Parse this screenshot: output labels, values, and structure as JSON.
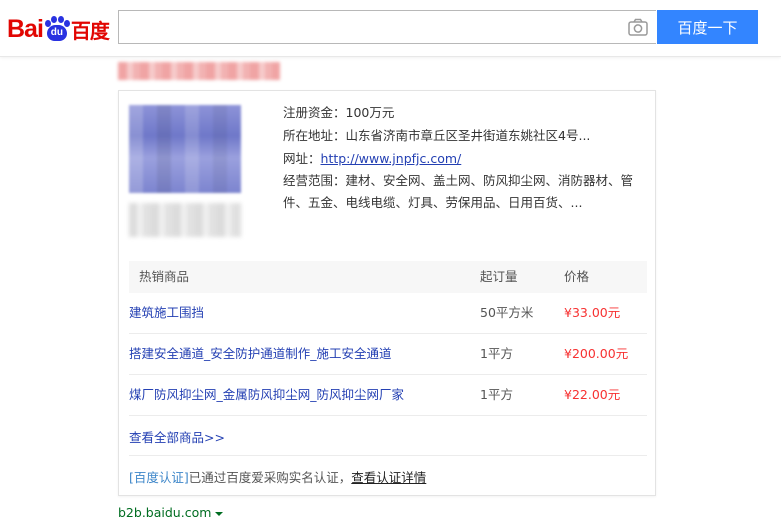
{
  "header": {
    "logo": {
      "latin": "Bai",
      "paw_text": "du",
      "chinese": "百度"
    },
    "search": {
      "value": "",
      "placeholder": ""
    },
    "search_button_label": "百度一下"
  },
  "card": {
    "info": {
      "capital_label": "注册资金：",
      "capital_value": "100万元",
      "address_label": "所在地址：",
      "address_value": "山东省济南市章丘区圣井街道东姚社区4号...",
      "website_label": "网址：",
      "website_url": "http://www.jnpfjc.com/",
      "scope_label": "经营范围：",
      "scope_value": "建材、安全网、盖土网、防风抑尘网、消防器材、管件、五金、电线电缆、灯具、劳保用品、日用百货、..."
    },
    "table": {
      "headers": [
        "热销商品",
        "起订量",
        "价格"
      ],
      "rows": [
        {
          "name": "建筑施工围挡",
          "moq": "50平方米",
          "price": "¥33.00元"
        },
        {
          "name": "搭建安全通道_安全防护通道制作_施工安全通道",
          "moq": "1平方",
          "price": "¥200.00元"
        },
        {
          "name": "煤厂防风抑尘网_金属防风抑尘网_防风抑尘网厂家",
          "moq": "1平方",
          "price": "¥22.00元"
        }
      ]
    },
    "view_all_label": "查看全部商品>>",
    "certification": {
      "tag": "[百度认证]",
      "text": "已通过百度爱采购实名认证，",
      "link": "查看认证详情"
    }
  },
  "source_url": "b2b.baidu.com",
  "colors": {
    "brand_red": "#e10602",
    "brand_blue": "#2932e1",
    "button_blue": "#3385ff",
    "link_blue": "#2440b3",
    "price_red": "#f73131",
    "source_green": "#006d21"
  }
}
